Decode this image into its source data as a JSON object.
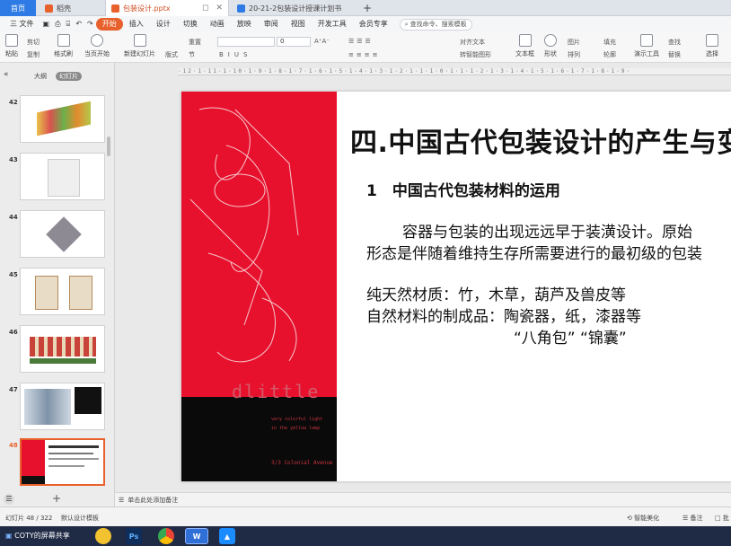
{
  "tabs": {
    "home": "首页",
    "t1": "稻壳",
    "t2": "包装设计.pptx",
    "t3": "20-21-2包装设计授课计划书",
    "add": "+"
  },
  "menu": {
    "file": "三 文件",
    "items": [
      "开始",
      "插入",
      "设计",
      "切换",
      "动画",
      "放映",
      "审阅",
      "视图",
      "开发工具",
      "会员专享"
    ],
    "search": "查找命令、搜索模板"
  },
  "ribbon": {
    "paste": "粘贴",
    "cut": "剪切",
    "copy": "复制",
    "format_painter": "格式刷",
    "from_current": "当页开始",
    "new_slide": "新建幻灯片",
    "layout": "版式",
    "section": "节",
    "reset": "重置",
    "font_size": "0",
    "text_box": "文本框",
    "shape": "形状",
    "arrange": "排列",
    "picture": "图片",
    "outline": "轮廓",
    "fill": "填充",
    "present_tool": "演示工具",
    "find": "查找",
    "replace": "替换",
    "select": "选择",
    "align_text": "对齐文本",
    "convert_smartart": "转智能图形"
  },
  "ruler": "·12·1·11·1·10·1·9·1·8·1·7·1·6·1·5·1·4·1·3·1·2·1·1·1·0·1·1·1·2·1·3·1·4·1·5·1·6·1·7·1·8·1·9·",
  "panel": {
    "collapse": "«",
    "outline_tab": "大纲",
    "slides_tab": "幻灯片",
    "thumbs": [
      {
        "num": "42"
      },
      {
        "num": "43"
      },
      {
        "num": "44"
      },
      {
        "num": "45"
      },
      {
        "num": "46"
      },
      {
        "num": "47"
      },
      {
        "num": "48"
      }
    ],
    "add": "+"
  },
  "slide": {
    "title": "四.中国古代包装设计的产生与变",
    "subtitle": "1　中国古代包装材料的运用",
    "p1": "容器与包装的出现远远早于装潢设计。原始",
    "p2": "形态是伴随着维持生存所需要进行的最初级的包装",
    "p3": "纯天然材质：竹，木草，葫芦及兽皮等",
    "p4": "自然材料的制成品：陶瓷器，纸，漆器等",
    "p5": "“八角包”  “锦囊”",
    "brand": "dlittle",
    "brand_small1": "very colorful light",
    "brand_small2": "in the yellow lamp",
    "brand_small3": "3/3  Colonial Avenue"
  },
  "notes": {
    "placeholder": "单击此处添加备注"
  },
  "status": {
    "slide_info": "幻灯片 48 / 322",
    "template": "默认设计模板",
    "smart_beautify": "智能美化",
    "notes": "备注",
    "batch": "批"
  },
  "taskbar": {
    "share": "COTY的屏幕共享"
  },
  "colors": {
    "accent": "#e8612c",
    "slide_red": "#e8112d",
    "home_tab": "#2f7be5"
  }
}
